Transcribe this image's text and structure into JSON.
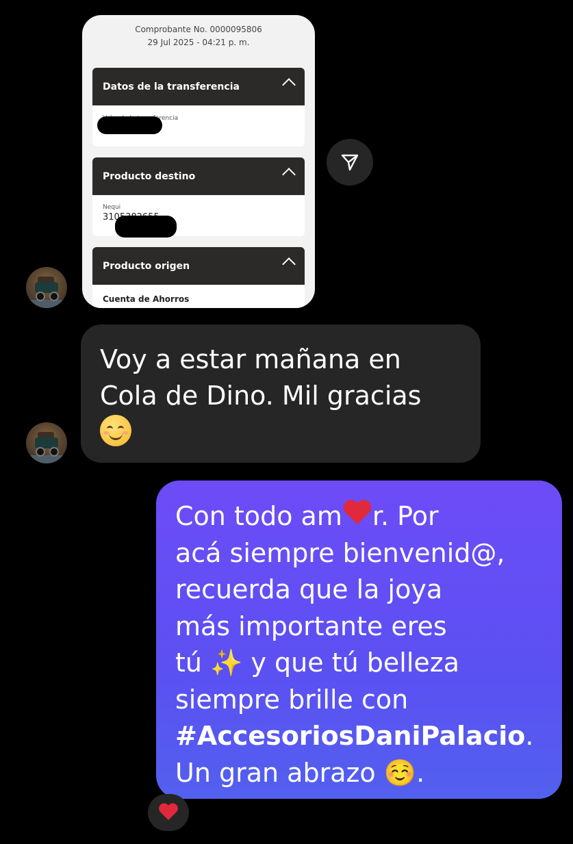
{
  "receipt": {
    "comprobante": "Comprobante No. 0000095806",
    "datetime": "29 Jul 2025 - 04:21 p. m.",
    "sections": [
      {
        "title": "Datos de la transferencia",
        "label": "Valor de la transferencia",
        "value": ""
      },
      {
        "title": "Producto destino",
        "label": "Nequi",
        "value": "3105382655"
      },
      {
        "title": "Producto origen",
        "label": "",
        "value": "Cuenta de Ahorros"
      }
    ]
  },
  "messages": {
    "incoming_text": "Voy a estar mañana en Cola de Dino. Mil gracias",
    "outgoing": {
      "line1a": "Con todo am",
      "line1b": "r.  Por",
      "line2": "acá siempre bienvenid@,",
      "line3": "recuerda que la joya",
      "line4": "más importante eres",
      "line5a": "tú ",
      "line5b": "✨",
      "line5c": " y que tú belleza",
      "line6": "siempre brille con",
      "hashtag": "#AccesoriosDaniPalacio",
      "hashtag_end": ".",
      "line8a": "Un gran abrazo ",
      "line8b": "☺️",
      "line8c": "."
    }
  },
  "icons": {
    "send": "paper-plane-icon",
    "reaction": "heart-icon"
  },
  "colors": {
    "background": "#000000",
    "incoming_bubble": "#262626",
    "outgoing_bubble_top": "#6d4cf7",
    "outgoing_bubble_bottom": "#5260ef",
    "heart": "#e0293a"
  }
}
